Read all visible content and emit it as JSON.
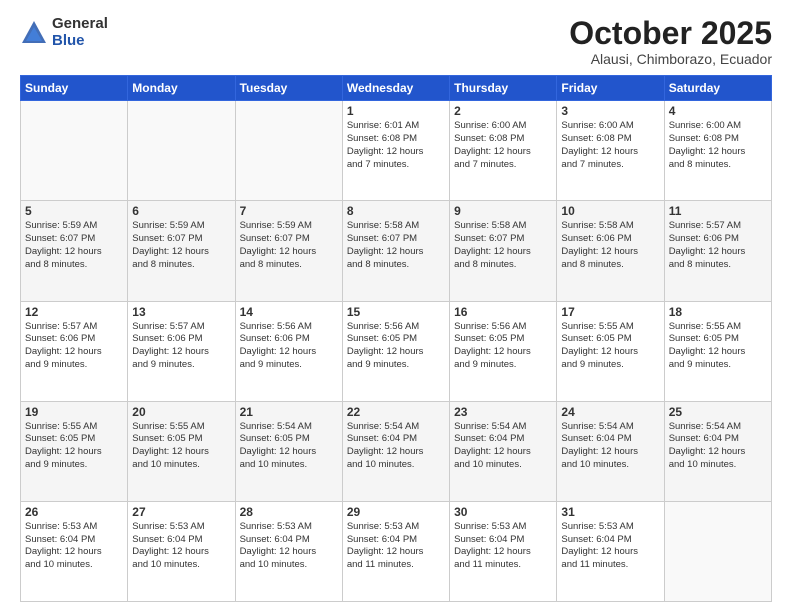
{
  "logo": {
    "general": "General",
    "blue": "Blue"
  },
  "title": "October 2025",
  "subtitle": "Alausi, Chimborazo, Ecuador",
  "days": [
    "Sunday",
    "Monday",
    "Tuesday",
    "Wednesday",
    "Thursday",
    "Friday",
    "Saturday"
  ],
  "weeks": [
    [
      {
        "num": "",
        "info": ""
      },
      {
        "num": "",
        "info": ""
      },
      {
        "num": "",
        "info": ""
      },
      {
        "num": "1",
        "info": "Sunrise: 6:01 AM\nSunset: 6:08 PM\nDaylight: 12 hours\nand 7 minutes."
      },
      {
        "num": "2",
        "info": "Sunrise: 6:00 AM\nSunset: 6:08 PM\nDaylight: 12 hours\nand 7 minutes."
      },
      {
        "num": "3",
        "info": "Sunrise: 6:00 AM\nSunset: 6:08 PM\nDaylight: 12 hours\nand 7 minutes."
      },
      {
        "num": "4",
        "info": "Sunrise: 6:00 AM\nSunset: 6:08 PM\nDaylight: 12 hours\nand 8 minutes."
      }
    ],
    [
      {
        "num": "5",
        "info": "Sunrise: 5:59 AM\nSunset: 6:07 PM\nDaylight: 12 hours\nand 8 minutes."
      },
      {
        "num": "6",
        "info": "Sunrise: 5:59 AM\nSunset: 6:07 PM\nDaylight: 12 hours\nand 8 minutes."
      },
      {
        "num": "7",
        "info": "Sunrise: 5:59 AM\nSunset: 6:07 PM\nDaylight: 12 hours\nand 8 minutes."
      },
      {
        "num": "8",
        "info": "Sunrise: 5:58 AM\nSunset: 6:07 PM\nDaylight: 12 hours\nand 8 minutes."
      },
      {
        "num": "9",
        "info": "Sunrise: 5:58 AM\nSunset: 6:07 PM\nDaylight: 12 hours\nand 8 minutes."
      },
      {
        "num": "10",
        "info": "Sunrise: 5:58 AM\nSunset: 6:06 PM\nDaylight: 12 hours\nand 8 minutes."
      },
      {
        "num": "11",
        "info": "Sunrise: 5:57 AM\nSunset: 6:06 PM\nDaylight: 12 hours\nand 8 minutes."
      }
    ],
    [
      {
        "num": "12",
        "info": "Sunrise: 5:57 AM\nSunset: 6:06 PM\nDaylight: 12 hours\nand 9 minutes."
      },
      {
        "num": "13",
        "info": "Sunrise: 5:57 AM\nSunset: 6:06 PM\nDaylight: 12 hours\nand 9 minutes."
      },
      {
        "num": "14",
        "info": "Sunrise: 5:56 AM\nSunset: 6:06 PM\nDaylight: 12 hours\nand 9 minutes."
      },
      {
        "num": "15",
        "info": "Sunrise: 5:56 AM\nSunset: 6:05 PM\nDaylight: 12 hours\nand 9 minutes."
      },
      {
        "num": "16",
        "info": "Sunrise: 5:56 AM\nSunset: 6:05 PM\nDaylight: 12 hours\nand 9 minutes."
      },
      {
        "num": "17",
        "info": "Sunrise: 5:55 AM\nSunset: 6:05 PM\nDaylight: 12 hours\nand 9 minutes."
      },
      {
        "num": "18",
        "info": "Sunrise: 5:55 AM\nSunset: 6:05 PM\nDaylight: 12 hours\nand 9 minutes."
      }
    ],
    [
      {
        "num": "19",
        "info": "Sunrise: 5:55 AM\nSunset: 6:05 PM\nDaylight: 12 hours\nand 9 minutes."
      },
      {
        "num": "20",
        "info": "Sunrise: 5:55 AM\nSunset: 6:05 PM\nDaylight: 12 hours\nand 10 minutes."
      },
      {
        "num": "21",
        "info": "Sunrise: 5:54 AM\nSunset: 6:05 PM\nDaylight: 12 hours\nand 10 minutes."
      },
      {
        "num": "22",
        "info": "Sunrise: 5:54 AM\nSunset: 6:04 PM\nDaylight: 12 hours\nand 10 minutes."
      },
      {
        "num": "23",
        "info": "Sunrise: 5:54 AM\nSunset: 6:04 PM\nDaylight: 12 hours\nand 10 minutes."
      },
      {
        "num": "24",
        "info": "Sunrise: 5:54 AM\nSunset: 6:04 PM\nDaylight: 12 hours\nand 10 minutes."
      },
      {
        "num": "25",
        "info": "Sunrise: 5:54 AM\nSunset: 6:04 PM\nDaylight: 12 hours\nand 10 minutes."
      }
    ],
    [
      {
        "num": "26",
        "info": "Sunrise: 5:53 AM\nSunset: 6:04 PM\nDaylight: 12 hours\nand 10 minutes."
      },
      {
        "num": "27",
        "info": "Sunrise: 5:53 AM\nSunset: 6:04 PM\nDaylight: 12 hours\nand 10 minutes."
      },
      {
        "num": "28",
        "info": "Sunrise: 5:53 AM\nSunset: 6:04 PM\nDaylight: 12 hours\nand 10 minutes."
      },
      {
        "num": "29",
        "info": "Sunrise: 5:53 AM\nSunset: 6:04 PM\nDaylight: 12 hours\nand 11 minutes."
      },
      {
        "num": "30",
        "info": "Sunrise: 5:53 AM\nSunset: 6:04 PM\nDaylight: 12 hours\nand 11 minutes."
      },
      {
        "num": "31",
        "info": "Sunrise: 5:53 AM\nSunset: 6:04 PM\nDaylight: 12 hours\nand 11 minutes."
      },
      {
        "num": "",
        "info": ""
      }
    ]
  ]
}
